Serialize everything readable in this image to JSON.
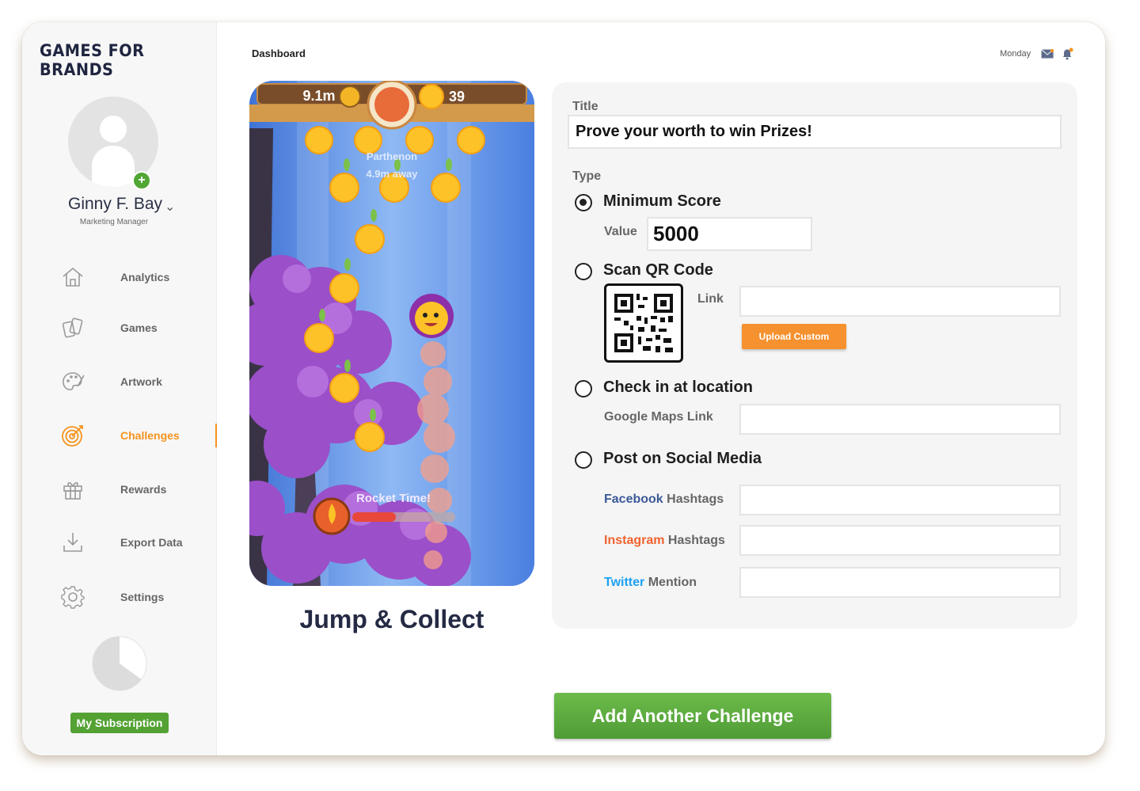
{
  "brand": "GAMES FOR BRANDS",
  "user": {
    "name": "Ginny F. Bay",
    "role": "Marketing Manager"
  },
  "nav": [
    {
      "label": "Analytics",
      "icon": "home-icon"
    },
    {
      "label": "Games",
      "icon": "cards-icon"
    },
    {
      "label": "Artwork",
      "icon": "palette-icon"
    },
    {
      "label": "Challenges",
      "icon": "target-icon",
      "active": true
    },
    {
      "label": "Rewards",
      "icon": "gift-icon"
    },
    {
      "label": "Export Data",
      "icon": "download-icon"
    },
    {
      "label": "Settings",
      "icon": "gear-icon"
    }
  ],
  "subscription": {
    "usage_percent": 65,
    "usage_label": "65%",
    "button": "My Subscription"
  },
  "header": {
    "breadcrumb": "Dashboard",
    "day": "Monday"
  },
  "game": {
    "name": "Jump & Collect",
    "hud_distance": "9.1m",
    "hud_score": "39",
    "landmark": "Parthenon",
    "landmark_distance": "4.9m away",
    "boost_text": "Rocket Time!"
  },
  "form": {
    "title_label": "Title",
    "title_value": "Prove your worth to win Prizes!",
    "type_label": "Type",
    "options": {
      "min_score": {
        "label": "Minimum Score",
        "value_label": "Value",
        "value": "5000",
        "selected": true
      },
      "qr": {
        "label": "Scan QR Code",
        "link_label": "Link",
        "upload_button": "Upload Custom"
      },
      "location": {
        "label": "Check in at location",
        "maps_label": "Google Maps Link"
      },
      "social": {
        "label": "Post on Social Media",
        "facebook_brand": "Facebook",
        "facebook_suffix": " Hashtags",
        "instagram_brand": "Instagram",
        "instagram_suffix": " Hashtags",
        "twitter_brand": "Twitter",
        "twitter_suffix": " Mention"
      }
    }
  },
  "add_button": "Add Another Challenge",
  "colors": {
    "accent": "#f5931e",
    "green": "#53a233",
    "facebook": "#3b5998",
    "instagram": "#f0622f",
    "twitter": "#1da1f2"
  }
}
